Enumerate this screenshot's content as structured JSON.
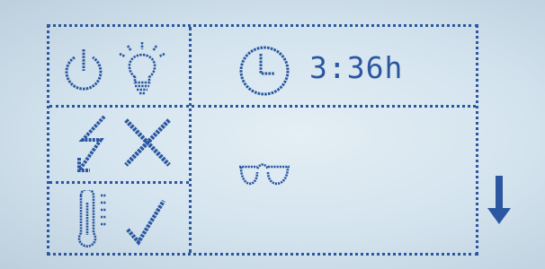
{
  "display": {
    "timer_value": "3:36h"
  },
  "icons": {
    "power": "power-icon",
    "light": "lightbulb-icon",
    "lightning": "lightning-icon",
    "cross": "cross-icon",
    "thermometer": "thermometer-icon",
    "check": "checkmark-icon",
    "clock": "clock-icon",
    "glasses": "glasses-icon",
    "scroll_down": "arrow-down-icon"
  },
  "colors": {
    "lcd_background": "#d3e3ee",
    "pixel_blue": "#2a57a0"
  }
}
